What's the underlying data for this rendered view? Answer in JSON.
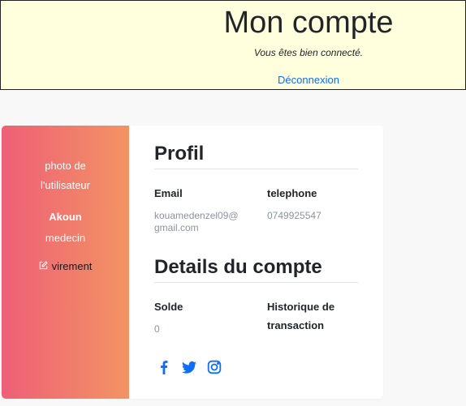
{
  "header": {
    "title": "Mon compte",
    "subtitle": "Vous êtes bien connecté.",
    "logout_label": "Déconnexion",
    "link_color": "#0d6efd"
  },
  "sidebar": {
    "photo_line1": "photo de",
    "photo_line2": "l'utilisateur",
    "name": "Akoun",
    "role": "medecin",
    "virement_label": "virement",
    "virement_icon": "edit-icon",
    "gradient_start": "#ee5f77",
    "gradient_end": "#f29463"
  },
  "profil": {
    "title": "Profil",
    "email_label": "Email",
    "email_value_line1": "kouamedenzel09@",
    "email_value_line2": "gmail.com",
    "phone_label": "telephone",
    "phone_value": "0749925547"
  },
  "compte": {
    "title": "Details du compte",
    "solde_label": "Solde",
    "solde_value": "0",
    "historique_line1": "Historique de",
    "historique_line2": "transaction"
  },
  "social": {
    "icons": [
      "facebook-icon",
      "twitter-icon",
      "instagram-icon"
    ],
    "color": "#0d6efd"
  }
}
